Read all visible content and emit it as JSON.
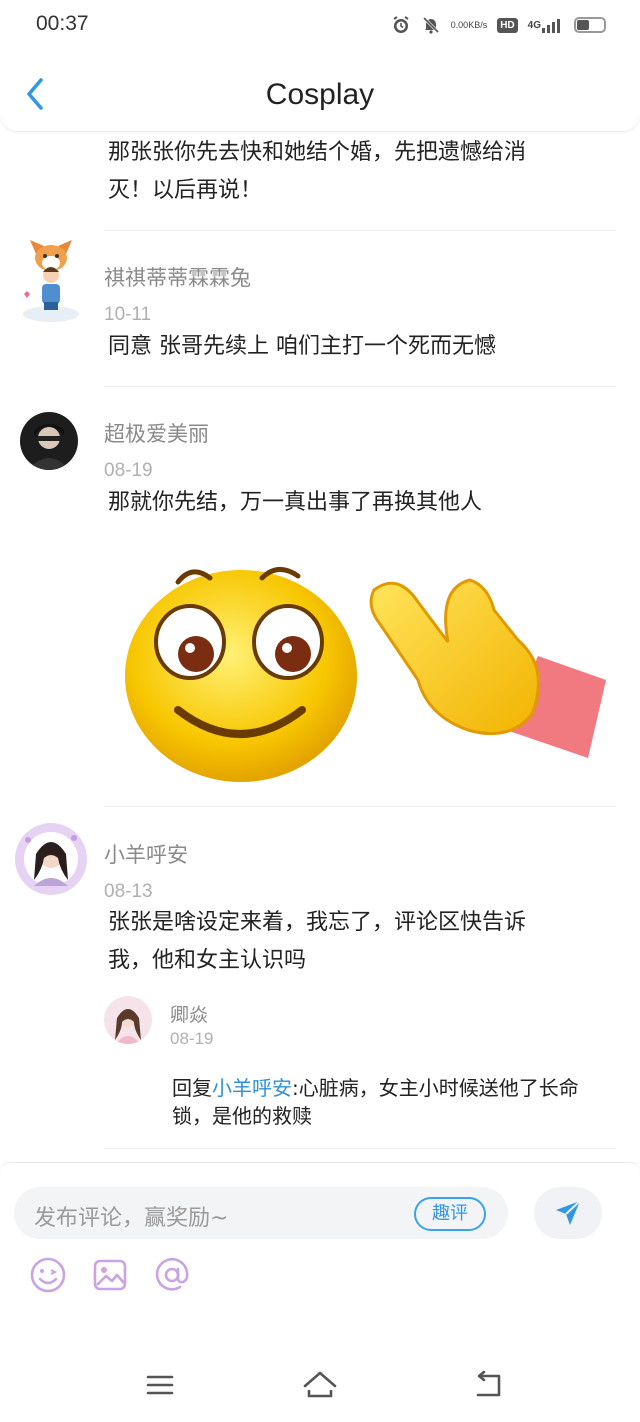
{
  "status": {
    "time": "00:37",
    "net_speed_value": "0.00",
    "net_speed_unit": "KB/s",
    "hd_label": "HD",
    "network_label": "4G"
  },
  "header": {
    "title": "Cosplay"
  },
  "comments": [
    {
      "text_line_1": "那张张你先去快和她结个婚，先把遗憾给消",
      "text_line_2": "灭！以后再说！"
    },
    {
      "username": "祺祺蒂蒂霖霖兔",
      "date": "10-11",
      "text": "同意 张哥先续上 咱们主打一个死而无憾"
    },
    {
      "username": "超极爱美丽",
      "date": "08-19",
      "text": "那就你先结，万一真出事了再换其他人",
      "sticker": "smiley-pointing-sticker"
    },
    {
      "username": "小羊呼安",
      "date": "08-13",
      "text_line_1": "张张是啥设定来着，我忘了，评论区快告诉",
      "text_line_2": "我，他和女主认识吗",
      "reply": {
        "username": "卿焱",
        "date": "08-19",
        "prefix": "回复",
        "target": "小羊呼安",
        "colon": ":",
        "text_line_1": "心脏病，女主小时候送他了长命",
        "text_line_2": "锁，是他的救赎"
      }
    }
  ],
  "composer": {
    "placeholder": "发布评论，赢奖励~",
    "quping_label": "趣评",
    "tools": [
      "emoji-icon",
      "image-icon",
      "mention-icon"
    ]
  },
  "colors": {
    "accent": "#2f97e5",
    "link": "#2f8fd6",
    "tool_purple": "#c9a3e3"
  }
}
